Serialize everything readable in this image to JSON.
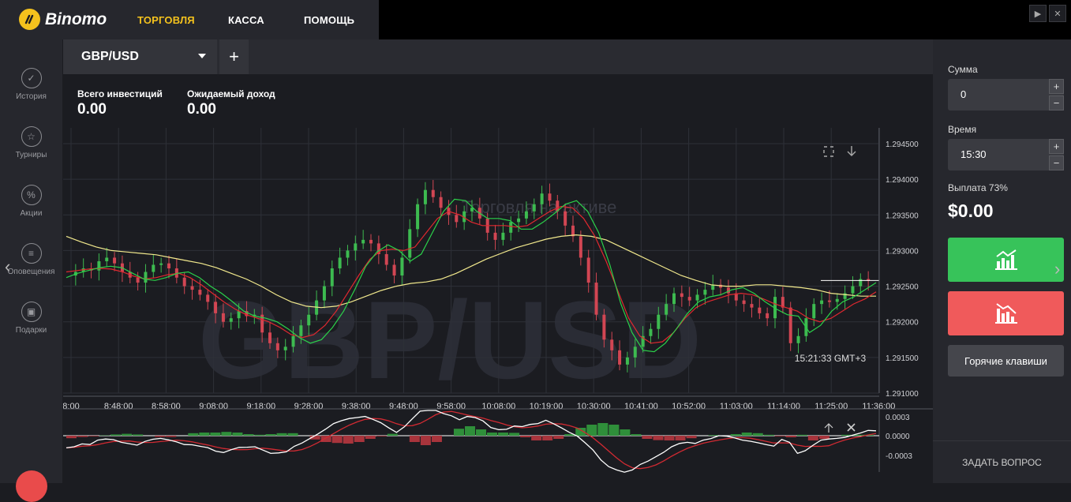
{
  "brand": {
    "name": "Binomo"
  },
  "nav": [
    {
      "label": "ТОРГОВЛЯ",
      "active": true
    },
    {
      "label": "КАССА",
      "active": false
    },
    {
      "label": "ПОМОЩЬ",
      "active": false
    }
  ],
  "sidebar": {
    "items": [
      {
        "label": "История",
        "icon": "history-icon"
      },
      {
        "label": "Турниры",
        "icon": "trophy-icon"
      },
      {
        "label": "Акции",
        "icon": "percent-icon"
      },
      {
        "label": "Оповещения",
        "icon": "notifications-icon"
      },
      {
        "label": "Подарки",
        "icon": "gift-icon"
      }
    ]
  },
  "asset_tab": {
    "name": "GBP/USD",
    "add": "+"
  },
  "stats": {
    "invested_label": "Всего инвестиций",
    "invested_value": "0.00",
    "expected_label": "Ожидаемый доход",
    "expected_value": "0.00"
  },
  "chart": {
    "watermark": "GBP/USD",
    "inactive_text": "Торговля на активе",
    "time_label": "15:21:33 GMT+3",
    "colors": {
      "up": "#3dbb50",
      "down": "#d24653",
      "ma_fast": "#2bd14a",
      "ma_mid": "#e0282f",
      "ma_slow": "#f2e98d",
      "ma_long": "#2a2fd9"
    }
  },
  "chart_data": {
    "type": "candlestick",
    "y_ticks": [
      "1.294500",
      "1.294000",
      "1.293500",
      "1.293000",
      "1.292500",
      "1.292000",
      "1.291500",
      "1.291000"
    ],
    "x_ticks": [
      "8:00",
      "8:48:00",
      "8:58:00",
      "9:08:00",
      "9:18:00",
      "9:28:00",
      "9:38:00",
      "9:48:00",
      "9:58:00",
      "10:08:00",
      "10:19:00",
      "10:30:00",
      "10:41:00",
      "10:52:00",
      "11:03:00",
      "11:14:00",
      "11:25:00",
      "11:36:00"
    ],
    "ylim": [
      1.291,
      1.2945
    ],
    "price_path": [
      1.29265,
      1.2927,
      1.29275,
      1.29272,
      1.29285,
      1.2929,
      1.29282,
      1.2927,
      1.29262,
      1.29255,
      1.2927,
      1.2928,
      1.29282,
      1.29275,
      1.29262,
      1.2925,
      1.29245,
      1.29238,
      1.29228,
      1.29212,
      1.292,
      1.29205,
      1.29215,
      1.29208,
      1.2921,
      1.29185,
      1.2917,
      1.2916,
      1.29165,
      1.2918,
      1.29195,
      1.2921,
      1.2923,
      1.2925,
      1.29275,
      1.2929,
      1.293,
      1.2931,
      1.29315,
      1.2931,
      1.29295,
      1.2928,
      1.29265,
      1.2929,
      1.2933,
      1.29365,
      1.29385,
      1.29375,
      1.2936,
      1.2935,
      1.2934,
      1.29355,
      1.2936,
      1.29345,
      1.29325,
      1.29315,
      1.29325,
      1.2934,
      1.29345,
      1.29355,
      1.29365,
      1.2938,
      1.2937,
      1.29355,
      1.29335,
      1.2932,
      1.2929,
      1.29255,
      1.2921,
      1.29175,
      1.2916,
      1.2914,
      1.2915,
      1.29165,
      1.2918,
      1.2919,
      1.2921,
      1.29225,
      1.2924,
      1.29235,
      1.2923,
      1.29238,
      1.29245,
      1.29252,
      1.29248,
      1.2924,
      1.2923,
      1.29225,
      1.2922,
      1.29212,
      1.29205,
      1.29235,
      1.2922,
      1.2917,
      1.2918,
      1.29205,
      1.29225,
      1.2923,
      1.29228,
      1.29232,
      1.2924,
      1.2925,
      1.2926,
      1.29258
    ],
    "ma_fast": [
      1.29262,
      1.29268,
      1.29272,
      1.29276,
      1.29278,
      1.29276,
      1.29268,
      1.2926,
      1.29258,
      1.29262,
      1.29268,
      1.2927,
      1.29262,
      1.2925,
      1.2924,
      1.29228,
      1.29215,
      1.29208,
      1.29205,
      1.292,
      1.2919,
      1.29178,
      1.2917,
      1.29175,
      1.29192,
      1.29215,
      1.29245,
      1.29278,
      1.29298,
      1.29308,
      1.293,
      1.29285,
      1.29295,
      1.29325,
      1.29355,
      1.29372,
      1.2937,
      1.29355,
      1.29345,
      1.29345,
      1.29342,
      1.2933,
      1.2933,
      1.2934,
      1.29352,
      1.29365,
      1.2937,
      1.29355,
      1.29325,
      1.2928,
      1.29225,
      1.29185,
      1.2916,
      1.29158,
      1.2917,
      1.2919,
      1.29212,
      1.29228,
      1.29235,
      1.29238,
      1.29245,
      1.29248,
      1.2924,
      1.29228,
      1.29218,
      1.2921,
      1.29208,
      1.29185,
      1.29195,
      1.29215,
      1.29228,
      1.29235,
      1.29245,
      1.29255
    ],
    "ma_mid": [
      1.2927,
      1.29272,
      1.29274,
      1.29275,
      1.29274,
      1.2927,
      1.29264,
      1.2926,
      1.29262,
      1.29266,
      1.29268,
      1.29262,
      1.29252,
      1.2924,
      1.29228,
      1.29218,
      1.2921,
      1.29205,
      1.292,
      1.29192,
      1.29182,
      1.29178,
      1.29182,
      1.29195,
      1.29215,
      1.2924,
      1.29265,
      1.29288,
      1.293,
      1.29302,
      1.293,
      1.29305,
      1.29325,
      1.29345,
      1.29355,
      1.2935,
      1.2934,
      1.29335,
      1.29335,
      1.29335,
      1.29333,
      1.29335,
      1.29345,
      1.29355,
      1.29362,
      1.2936,
      1.29345,
      1.2932,
      1.29285,
      1.29245,
      1.29205,
      1.2918,
      1.2917,
      1.29172,
      1.29185,
      1.29205,
      1.2922,
      1.29228,
      1.29233,
      1.29238,
      1.2924,
      1.29238,
      1.29232,
      1.29225,
      1.2922,
      1.29215,
      1.29205,
      1.292,
      1.29205,
      1.29215,
      1.29225,
      1.29232,
      1.29242
    ],
    "ma_slow": [
      1.2932,
      1.29312,
      1.29305,
      1.293,
      1.29298,
      1.29296,
      1.29294,
      1.2929,
      1.29286,
      1.29282,
      1.29276,
      1.29268,
      1.2926,
      1.2925,
      1.29238,
      1.29228,
      1.29222,
      1.2922,
      1.29222,
      1.29228,
      1.29236,
      1.29244,
      1.2925,
      1.29254,
      1.29256,
      1.2926,
      1.29268,
      1.29278,
      1.29288,
      1.29296,
      1.29304,
      1.2931,
      1.29316,
      1.2932,
      1.29322,
      1.2932,
      1.29315,
      1.29305,
      1.29295,
      1.29285,
      1.29275,
      1.29265,
      1.29258,
      1.29252,
      1.2925,
      1.2925,
      1.29252,
      1.29252,
      1.2925,
      1.29248,
      1.29245,
      1.2924,
      1.29238,
      1.29236,
      1.29236
    ]
  },
  "macd": {
    "ticks": [
      "0.0003",
      "0.0000",
      "-0.0003"
    ]
  },
  "rightpanel": {
    "amount_label": "Сумма",
    "amount_value": "0",
    "time_label": "Время",
    "time_value": "15:30",
    "payout_label": "Выплата 73%",
    "payout_value": "$0.00",
    "up_color": "#37c35a",
    "down_color": "#f05a5b",
    "hotkeys": "Горячие клавиши",
    "ask": "ЗАДАТЬ ВОПРОС"
  }
}
